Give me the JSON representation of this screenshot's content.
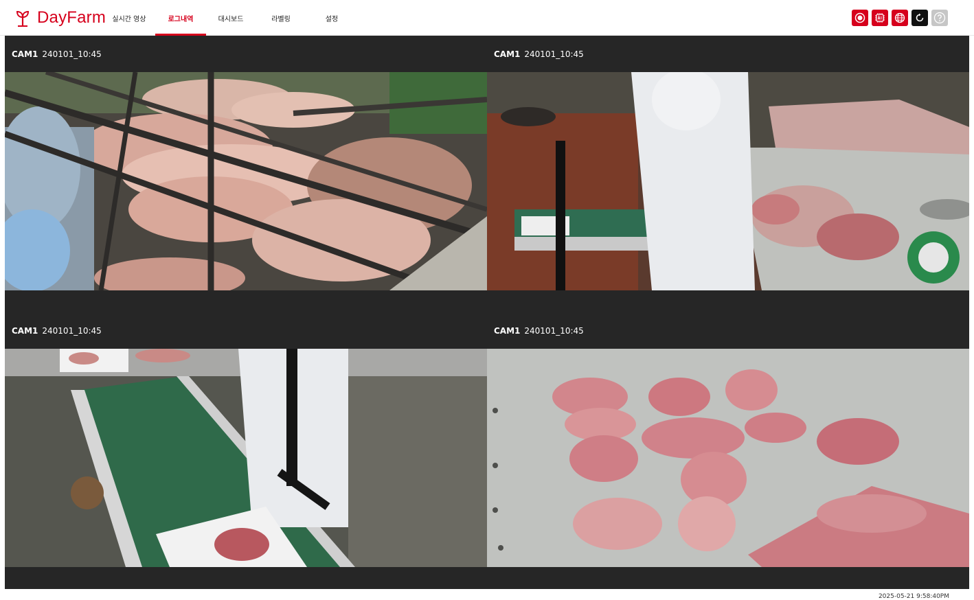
{
  "app": {
    "brand": "DayFarm"
  },
  "nav": {
    "items": [
      {
        "label": "실시간 영상"
      },
      {
        "label": "로그내역"
      },
      {
        "label": "대시보드"
      },
      {
        "label": "라벨링"
      },
      {
        "label": "설정"
      }
    ],
    "active_index": 1
  },
  "toolbar": {
    "buttons": [
      {
        "icon": "record-icon"
      },
      {
        "icon": "ai-icon"
      },
      {
        "icon": "globe-icon"
      },
      {
        "icon": "refresh-icon"
      },
      {
        "icon": "help-icon"
      }
    ]
  },
  "cameras": [
    {
      "id": "CAM1",
      "timestamp": "240101_10:45",
      "scene": "pigs in pen"
    },
    {
      "id": "CAM1",
      "timestamp": "240101_10:45",
      "scene": "worker at meat table"
    },
    {
      "id": "CAM1",
      "timestamp": "240101_10:45",
      "scene": "conveyor belt with tray"
    },
    {
      "id": "CAM1",
      "timestamp": "240101_10:45",
      "scene": "pork cuts on steel table"
    }
  ],
  "footer": {
    "timestamp": "2025-05-21 9:58:40PM"
  },
  "colors": {
    "brand_red": "#d6001c",
    "panel_dark": "#262626",
    "toolbar_dark": "#111111",
    "toolbar_grey": "#c6c6c6"
  }
}
